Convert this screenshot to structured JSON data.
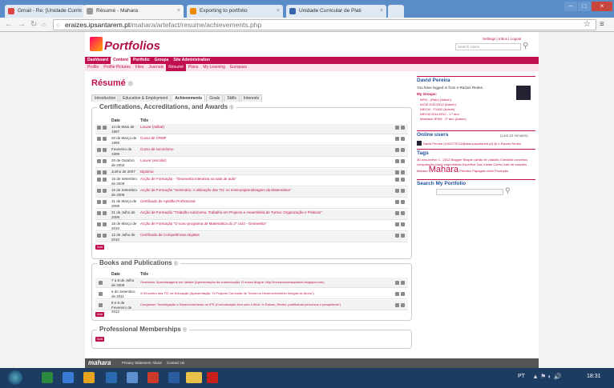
{
  "browser": {
    "tabs": [
      {
        "label": "Gmail - Re: [Unidade Curric",
        "color": "#d44"
      },
      {
        "label": "Résumé - Mahara",
        "color": "#999"
      },
      {
        "label": "Exporting to portfolio",
        "color": "#e80"
      },
      {
        "label": "Unidade Curricular de Plati",
        "color": "#36a"
      }
    ],
    "url_scheme": "",
    "url_host": "eraizes.ipsantarem.pt",
    "url_path": "/mahara/artefact/resume/achievements.php",
    "clock": "18:31",
    "lang": "PT"
  },
  "mahara": {
    "logo_text": "Portfolios",
    "top_links": [
      "Settings",
      "Inbox",
      "Logout"
    ],
    "search_placeholder": "Search Users",
    "main_nav": [
      "Dashboard",
      "Content",
      "Portfolio",
      "Groups",
      "Site Administration"
    ],
    "main_nav_selected": 1,
    "sub_nav": [
      "Profile",
      "Profile Pictures",
      "Files",
      "Journals",
      "Résumé",
      "Plans",
      "My Learning",
      "Europass"
    ],
    "sub_nav_selected": 4,
    "page_title": "Résumé",
    "page_tabs": [
      "Introduction",
      "Education & Employment",
      "Achievements",
      "Goals",
      "Skills",
      "Interests"
    ],
    "page_tab_selected": 2,
    "col_date": "Date",
    "col_title": "Title",
    "add_label": "Add",
    "certifications": {
      "heading": "Certifications, Accreditations, and Awards",
      "rows": [
        {
          "date": "14 de Maio de 1997",
          "title": "Louvor (militar)"
        },
        {
          "date": "20 de Março de 1998",
          "title": "Curso de CRMF"
        },
        {
          "date": "Fevereiro de 1999",
          "title": "Curso de socorrismo"
        },
        {
          "date": "20 de Outubro de 2002",
          "title": "Louvor (escolar)"
        },
        {
          "date": "Junho de 2007",
          "title": "Diploma"
        },
        {
          "date": "15 de Setembro de 2008",
          "title": "Acção de Formação - \"Geometria interativa na sala de aula\""
        },
        {
          "date": "15 de Setembro de 2008",
          "title": "Acção de Formação \"Seminário: A utilização das TIC no ensino/aprendizagem da Matemática\""
        },
        {
          "date": "31 de Março de 2009",
          "title": "Certificado de Aptidão Profissional"
        },
        {
          "date": "31 de Julho de 2009",
          "title": "Acção de Formação \"Trabalho Autónomo, Trabalho em Projecto e Assembleia de Turma: Organização e Práticas\""
        },
        {
          "date": "16 de Março de 2010",
          "title": "Acção de Formação \"O novo programa de Matemática do 2º ciclo - Geometria\""
        },
        {
          "date": "12 de Julho de 2010",
          "title": "Certificado de Competências Digitais"
        }
      ]
    },
    "books": {
      "heading": "Books and Publications",
      "rows": [
        {
          "date": "7 a 8 de Julho de 2009",
          "title": "Seminário: Aprendizagens em debate (Apresentação da comunicação 'O nosso blogue: http://mundocarmaiquintos.blogspot.com)"
        },
        {
          "date": "6 de Setembro de 2011",
          "title": "XI Encontro das TIC na Educação (Apresentação \"O Projecto Curricular de Turma no Desenvolvimento Integral do Aluno\")"
        },
        {
          "date": "8 e 9 de Fevereiro de 2012",
          "title": "Congresso \"Investigação e Desenvolvimento no IPS (Comunicação livre com o título \"e-Raízes_Redes: partilhando percursos e perspetivas\")"
        }
      ]
    },
    "memberships": {
      "heading": "Professional Memberships"
    },
    "sidebar": {
      "user": "David Pereira",
      "login_info": "You have logged in from e-Raízes Redes.",
      "groups_label": "My Groups:",
      "groups": [
        "APIU - (Raiu) (Admin)",
        "IACM 2011/2012 (Admin)",
        "NIECM - F1A02 (Admin)",
        "NIECM 2011/2012 - 1.º ano",
        "Mestrado IESM - 2º ano (Admin)"
      ],
      "online_heading": "Online users",
      "online_note": "(Last 10 minutes)",
      "online_user": "David Pereira (1003779742@alas.ipsantarem.pt) @ e-Raízes Redes",
      "tags_heading": "Tags",
      "tags": [
        "3D",
        "ano-lectivo 1 - 2012",
        "Blogger",
        "Blogue",
        "cartão de cidadão",
        "Checklist",
        "conceitos",
        "computação cloud",
        "engenharias",
        "Expertise",
        "Das Várias Cores",
        "Lista de",
        "ovações",
        "Mahara",
        "Pascal",
        "Petróleo",
        "Papagaio",
        "meio",
        "Produção"
      ],
      "tags_big": "Mahara",
      "search_heading": "Search My Portfolio"
    },
    "footer_links": [
      "Privacy Statement",
      "About",
      "Contact Us"
    ],
    "footer_logo": "mahara"
  },
  "colors": {
    "accent": "#c01050",
    "link": "#2050a0",
    "taskbar": "#1c3c62"
  }
}
